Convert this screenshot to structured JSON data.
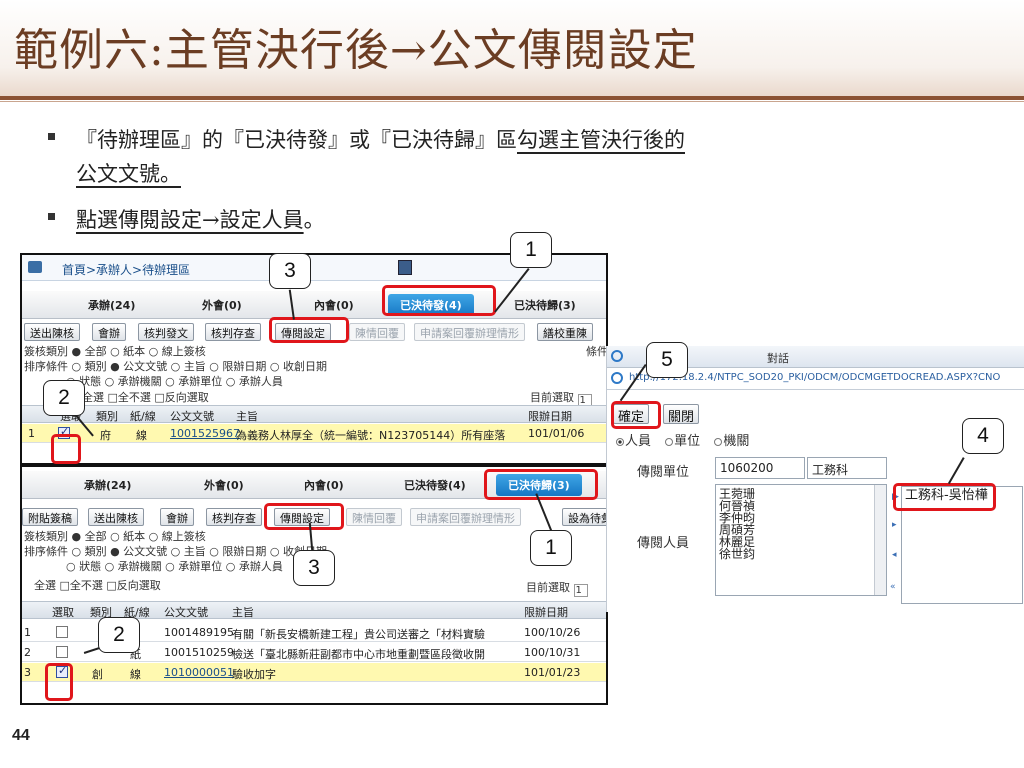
{
  "slide": {
    "title": "範例六:主管決行後→公文傳閱設定",
    "bullet1_part1": "『待辦理區』的『已決待發』或『已決待歸』區",
    "bullet1_part2_underlined": "勾選主管決行後的",
    "bullet1_line2_underlined": "公文文號。",
    "bullet2_underlined": "點選傳閱設定→設定人員",
    "bullet2_tail": "。",
    "page_number": "44"
  },
  "panel_top": {
    "breadcrumb": "首頁>承辦人>待辦理區",
    "tabs": [
      "承辦(24)",
      "外會(0)",
      "內會(0)",
      "已決待發(4)",
      "已決待歸(3)"
    ],
    "active_tab": "已決待發(4)",
    "buttons": [
      "送出陳核",
      "會辦",
      "核判發文",
      "核判存查",
      "傳閱設定",
      "陳情回覆",
      "申請案回覆辦理情形",
      "繕校重陳"
    ],
    "disabled_buttons": [
      "陳情回覆",
      "申請案回覆辦理情形"
    ],
    "option_line1": "簽核類別 ● 全部 ○ 紙本 ○ 線上簽核",
    "option_line2": "排序條件 ○ 類別 ● 公文文號 ○ 主旨 ○ 限辦日期 ○ 收創日期",
    "option_line3": "○ 狀態 ○ 承辦機關 ○ 承辦單位 ○ 承辦人員",
    "select_line": "全選 □全不選 □反向選取",
    "right_label_top": "條件",
    "selected_count_label": "目前選取",
    "selected_count": "1",
    "columns": [
      "選取",
      "類別",
      "紙/線",
      "公文文號",
      "主旨",
      "限辦日期"
    ],
    "rows": [
      {
        "no": "1",
        "checked": true,
        "type": "府",
        "media": "線",
        "doc_no": "1001525967",
        "subject": "為義務人林厚全（統一編號：N123705144）所有座落",
        "due": "101/01/06"
      }
    ]
  },
  "panel_bottom": {
    "tabs": [
      "承辦(24)",
      "外會(0)",
      "內會(0)",
      "已決待發(4)",
      "已決待歸(3)"
    ],
    "active_tab": "已決待歸(3)",
    "buttons": [
      "附貼簽稿",
      "送出陳核",
      "會辦",
      "核判存查",
      "傳閱設定",
      "陳情回覆",
      "申請案回覆辦理情形",
      "設為待彙辦"
    ],
    "disabled_buttons": [
      "陳情回覆",
      "申請案回覆辦理情形"
    ],
    "option_line1": "簽核類別 ● 全部 ○ 紙本 ○ 線上簽核",
    "option_line2": "排序條件 ○ 類別 ● 公文文號 ○ 主旨 ○ 限辦日期 ○ 收創日期",
    "option_line3": "○ 狀態 ○ 承辦機關 ○ 承辦單位 ○ 承辦人員",
    "select_line": "全選 □全不選 □反向選取",
    "selected_count_label": "目前選取",
    "selected_count": "1",
    "columns": [
      "選取",
      "類別",
      "紙/線",
      "公文文號",
      "主旨",
      "限辦日期"
    ],
    "rows": [
      {
        "no": "1",
        "checked": false,
        "type": "",
        "media": "",
        "doc_no": "1001489195",
        "subject": "有關「新長安橋新建工程」貴公司送審之「材料實驗",
        "due": "100/10/26"
      },
      {
        "no": "2",
        "checked": false,
        "type": "",
        "media": "紙",
        "doc_no": "1001510259",
        "subject": "檢送「臺北縣新莊副都市中心市地重劃暨區段徵收開",
        "due": "100/10/31"
      },
      {
        "no": "3",
        "checked": true,
        "type": "創",
        "media": "線",
        "doc_no": "1010000051",
        "subject": "驗收加字",
        "due": "101/01/23"
      }
    ]
  },
  "dialog": {
    "title_fragment": "對話",
    "url": "http://172.18.2.4/NTPC_SOD20_PKI/ODCM/ODCMGETDOCREAD.ASPX?CNO",
    "confirm_button": "確定",
    "close_button": "關閉",
    "scope_options": [
      "人員",
      "單位",
      "機關"
    ],
    "scope_selected": "人員",
    "unit_label": "傳閱單位",
    "unit_code": "1060200",
    "unit_name": "工務科",
    "people_label": "傳閱人員",
    "people": [
      "王菀珊",
      "何晉禎",
      "李仲昀",
      "周碩芳",
      "林麗足",
      "徐世鈞"
    ],
    "selected_people": [
      "工務科-吳怡樺"
    ]
  },
  "callouts": [
    "1",
    "2",
    "3",
    "1",
    "2",
    "3",
    "4",
    "5"
  ],
  "colors": {
    "highlight": "#e0161b",
    "active_tab": "#1677c4",
    "title": "#6b3d23"
  }
}
